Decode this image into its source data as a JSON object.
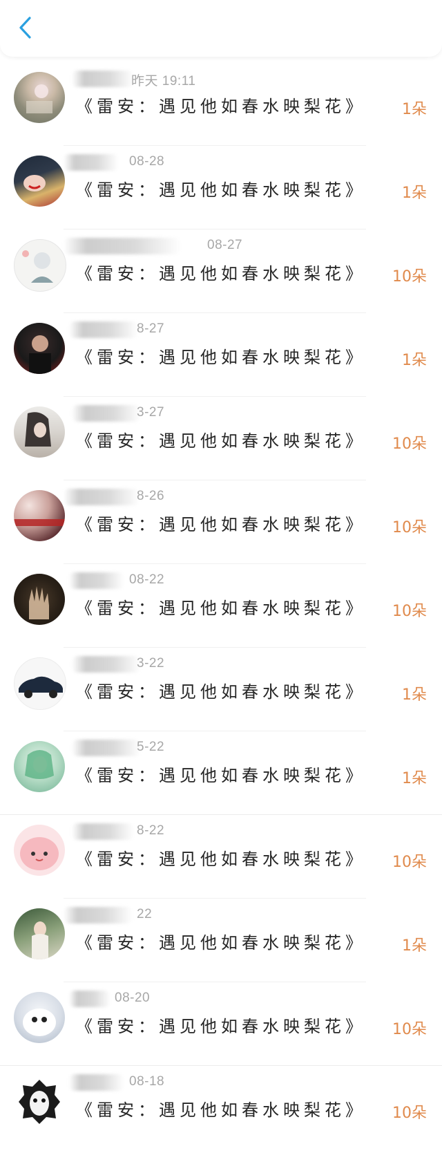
{
  "header": {
    "back_icon": "chevron-left-icon",
    "accent": "#2aa0e0"
  },
  "items": [
    {
      "date": "昨天 19:11",
      "title": "《雷安：遇见他如春水映梨花》",
      "count": "1朵"
    },
    {
      "date": "08-28",
      "title": "《雷安：遇见他如春水映梨花》",
      "count": "1朵"
    },
    {
      "date": "08-27",
      "title": "《雷安：遇见他如春水映梨花》",
      "count": "10朵"
    },
    {
      "date": "8-27",
      "title": "《雷安：遇见他如春水映梨花》",
      "count": "1朵"
    },
    {
      "date": "3-27",
      "title": "《雷安：遇见他如春水映梨花》",
      "count": "10朵"
    },
    {
      "date": "8-26",
      "title": "《雷安：遇见他如春水映梨花》",
      "count": "10朵"
    },
    {
      "date": "08-22",
      "title": "《雷安：遇见他如春水映梨花》",
      "count": "10朵"
    },
    {
      "date": "3-22",
      "title": "《雷安：遇见他如春水映梨花》",
      "count": "1朵"
    },
    {
      "date": "5-22",
      "title": "《雷安：遇见他如春水映梨花》",
      "count": "1朵"
    },
    {
      "date": "8-22",
      "title": "《雷安：遇见他如春水映梨花》",
      "count": "10朵"
    },
    {
      "date": "22",
      "title": "《雷安：遇见他如春水映梨花》",
      "count": "1朵"
    },
    {
      "date": "08-20",
      "title": "《雷安：遇见他如春水映梨花》",
      "count": "10朵"
    },
    {
      "date": "08-18",
      "title": "《雷安：遇见他如春水映梨花》",
      "count": "10朵"
    }
  ],
  "colors": {
    "count": "#e08a4c",
    "date": "#a7a7a7",
    "title": "#262626"
  }
}
